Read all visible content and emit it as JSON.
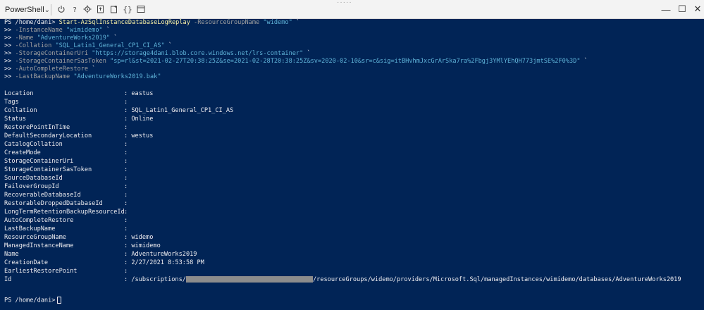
{
  "window": {
    "tab_label": "PowerShell",
    "dots": "·····",
    "minimize": "—",
    "maximize": "☐",
    "close": "✕"
  },
  "toolbar_icons": [
    "power-icon",
    "help-icon",
    "settings-icon",
    "upload-icon",
    "download-icon",
    "braces-icon",
    "webpreview-icon"
  ],
  "terminal": {
    "prompt": "PS /home/dani>",
    "command_lines": [
      {
        "prefix": "PS /home/dani> ",
        "cmd": "Start-AzSqlInstanceDatabaseLogReplay",
        "param": " -ResourceGroupName ",
        "str": "\"widemo\"",
        "tail": " `"
      },
      {
        "prefix": ">> ",
        "cmd": "",
        "param": "-InstanceName ",
        "str": "\"wimidemo\"",
        "tail": " `"
      },
      {
        "prefix": ">> ",
        "cmd": "",
        "param": "-Name ",
        "str": "\"AdventureWorks2019\"",
        "tail": " `"
      },
      {
        "prefix": ">> ",
        "cmd": "",
        "param": "-Collation ",
        "str": "\"SQL_Latin1_General_CP1_CI_AS\"",
        "tail": " `"
      },
      {
        "prefix": ">> ",
        "cmd": "",
        "param": "-StorageContainerUri ",
        "str": "\"https://storage4dani.blob.core.windows.net/lrs-container\"",
        "tail": " `"
      },
      {
        "prefix": ">> ",
        "cmd": "",
        "param": "-StorageContainerSasToken ",
        "str": "\"sp=rl&st=2021-02-27T20:38:25Z&se=2021-02-28T20:38:25Z&sv=2020-02-10&sr=c&sig=itBHvhmJxcGrArSka7ra%2Fbgj3YMlYEhQH773jmtSE%2F0%3D\"",
        "tail": " `"
      },
      {
        "prefix": ">> ",
        "cmd": "",
        "param": "-AutoCompleteRestore",
        "str": "",
        "tail": " `"
      },
      {
        "prefix": ">> ",
        "cmd": "",
        "param": "-LastBackupName ",
        "str": "\"AdventureWorks2019.bak\"",
        "tail": ""
      }
    ],
    "output": [
      {
        "key": "Location",
        "value": ": eastus"
      },
      {
        "key": "Tags",
        "value": ":"
      },
      {
        "key": "Collation",
        "value": ": SQL_Latin1_General_CP1_CI_AS"
      },
      {
        "key": "Status",
        "value": ": Online"
      },
      {
        "key": "RestorePointInTime",
        "value": ":"
      },
      {
        "key": "DefaultSecondaryLocation",
        "value": ": westus"
      },
      {
        "key": "CatalogCollation",
        "value": ":"
      },
      {
        "key": "CreateMode",
        "value": ":"
      },
      {
        "key": "StorageContainerUri",
        "value": ":"
      },
      {
        "key": "StorageContainerSasToken",
        "value": ":"
      },
      {
        "key": "SourceDatabaseId",
        "value": ":"
      },
      {
        "key": "FailoverGroupId",
        "value": ":"
      },
      {
        "key": "RecoverableDatabaseId",
        "value": ":"
      },
      {
        "key": "RestorableDroppedDatabaseId",
        "value": ":"
      },
      {
        "key": "LongTermRetentionBackupResourceId",
        "value": ":"
      },
      {
        "key": "AutoCompleteRestore",
        "value": ":"
      },
      {
        "key": "LastBackupName",
        "value": ":"
      },
      {
        "key": "ResourceGroupName",
        "value": ": widemo"
      },
      {
        "key": "ManagedInstanceName",
        "value": ": wimidemo"
      },
      {
        "key": "Name",
        "value": ": AdventureWorks2019"
      },
      {
        "key": "CreationDate",
        "value": ": 2/27/2021 8:53:58 PM"
      },
      {
        "key": "EarliestRestorePoint",
        "value": ":"
      }
    ],
    "id_line": {
      "key": "Id",
      "prefix": ": /subscriptions/",
      "suffix": "/resourceGroups/widemo/providers/Microsoft.Sql/managedInstances/wimidemo/databases/AdventureWorks2019"
    },
    "final_prompt": "PS /home/dani>"
  }
}
